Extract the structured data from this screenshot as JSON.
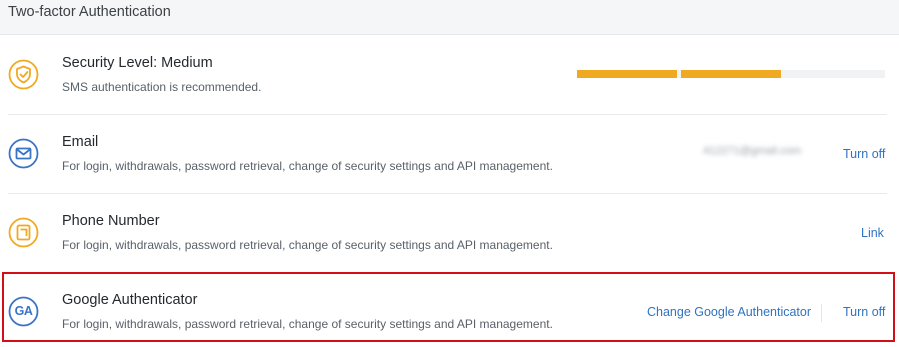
{
  "header": {
    "title": "Two-factor Authentication"
  },
  "colors": {
    "accent_orange": "#f0aa22",
    "accent_blue": "#3a74c6",
    "link_blue": "#2f73c3",
    "highlight_red": "#d20f17"
  },
  "rows": {
    "security": {
      "icon": "shield-check-icon",
      "title": "Security Level: Medium",
      "desc": "SMS authentication is recommended.",
      "level_filled_segments": 2,
      "level_total_segments": 3
    },
    "email": {
      "icon": "envelope-icon",
      "title": "Email",
      "desc": "For login, withdrawals, password retrieval, change of security settings and API management.",
      "value_masked": "412271@gmail.com",
      "action": "Turn off"
    },
    "phone": {
      "icon": "phone-icon",
      "title": "Phone Number",
      "desc": "For login, withdrawals, password retrieval, change of security settings and API management.",
      "action": "Link"
    },
    "google": {
      "icon": "google-authenticator-icon",
      "icon_text": "GA",
      "title": "Google Authenticator",
      "desc": "For login, withdrawals, password retrieval, change of security settings and API management.",
      "action_change": "Change Google Authenticator",
      "action_off": "Turn off"
    }
  }
}
